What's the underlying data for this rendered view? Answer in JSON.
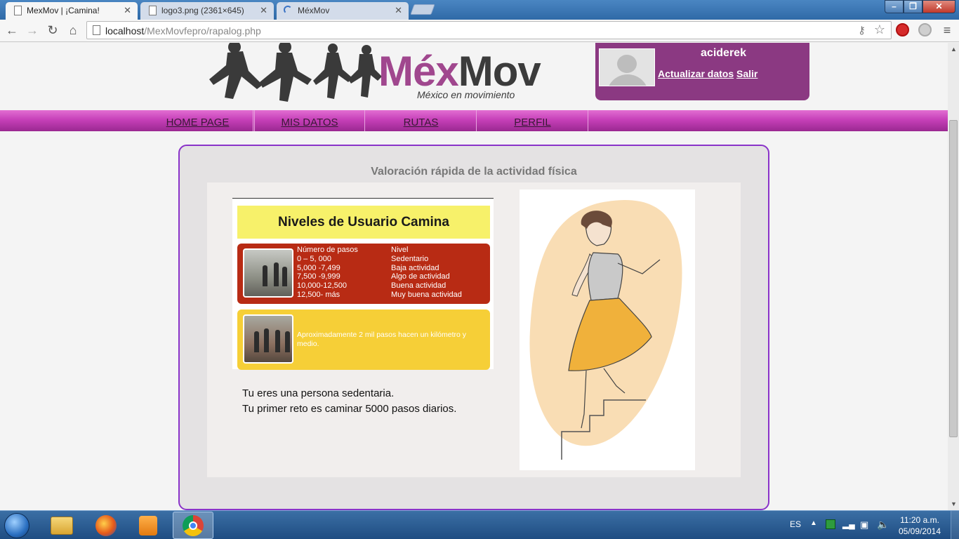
{
  "browser": {
    "tabs": [
      {
        "label": "MexMov | ¡Camina!"
      },
      {
        "label": "logo3.png (2361×645)"
      },
      {
        "label": "MéxMov"
      }
    ],
    "url_host": "localhost",
    "url_path": "/MexMovfepro/rapalog.php"
  },
  "header": {
    "brand_part1": "Méx",
    "brand_part2": "Mov",
    "tagline": "México en movimiento"
  },
  "user": {
    "username": "aciderek",
    "update_label": "Actualizar datos",
    "logout_label": "Salir"
  },
  "nav": {
    "items": [
      {
        "label": "HOME PAGE"
      },
      {
        "label": "MIS DATOS"
      },
      {
        "label": "RUTAS"
      },
      {
        "label": "PERFIL"
      }
    ]
  },
  "main": {
    "title": "Valoración rápida de la actividad física",
    "levels": {
      "heading": "Niveles de Usuario Camina",
      "col1_header": "Número de pasos",
      "col2_header": "Nivel",
      "rows": [
        {
          "steps": "0 – 5, 000",
          "level": "Sedentario"
        },
        {
          "steps": "5,000 -7,499",
          "level": "Baja actividad"
        },
        {
          "steps": "7,500 -9,999",
          "level": "Algo de actividad"
        },
        {
          "steps": "10,000-12,500",
          "level": "Buena actividad"
        },
        {
          "steps": "12,500- más",
          "level": "Muy buena actividad"
        }
      ],
      "note": "Aproximadamente 2 mil pasos hacen un kilómetro y medio."
    },
    "result_line1": "Tu eres una persona sedentaria.",
    "result_line2": "Tu primer reto es caminar 5000 pasos diarios."
  },
  "taskbar": {
    "language": "ES",
    "time": "11:20 a.m.",
    "date": "05/09/2014"
  },
  "colors": {
    "brand_purple": "#8b3982",
    "nav_magenta": "#c640b8",
    "card_border": "#8a33c9",
    "levels_red": "#b82b14",
    "levels_yellow": "#f6cf37"
  }
}
